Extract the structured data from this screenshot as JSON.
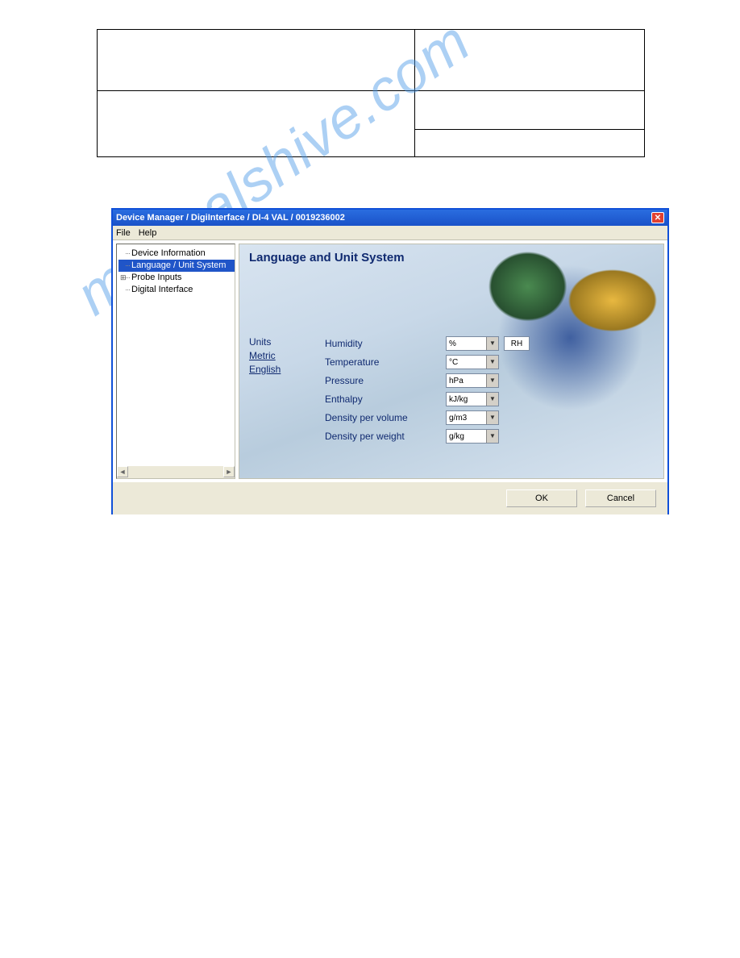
{
  "window": {
    "title": "Device Manager / DigiInterface / DI-4 VAL / 0019236002",
    "menus": {
      "file": "File",
      "help": "Help"
    }
  },
  "tree": {
    "items": [
      {
        "label": "Device Information",
        "selected": false,
        "expandable": false
      },
      {
        "label": "Language / Unit System",
        "selected": true,
        "expandable": false
      },
      {
        "label": "Probe Inputs",
        "selected": false,
        "expandable": true
      },
      {
        "label": "Digital Interface",
        "selected": false,
        "expandable": false
      }
    ]
  },
  "content": {
    "heading": "Language and Unit System",
    "units_label": "Units",
    "links": {
      "metric": "Metric",
      "english": "English"
    },
    "rows": [
      {
        "label": "Humidity",
        "value": "%",
        "extra": "RH"
      },
      {
        "label": "Temperature",
        "value": "°C"
      },
      {
        "label": "Pressure",
        "value": "hPa"
      },
      {
        "label": "Enthalpy",
        "value": "kJ/kg"
      },
      {
        "label": "Density per volume",
        "value": "g/m3"
      },
      {
        "label": "Density per weight",
        "value": "g/kg"
      }
    ]
  },
  "buttons": {
    "ok": "OK",
    "cancel": "Cancel"
  },
  "watermark": "manualshive.com"
}
